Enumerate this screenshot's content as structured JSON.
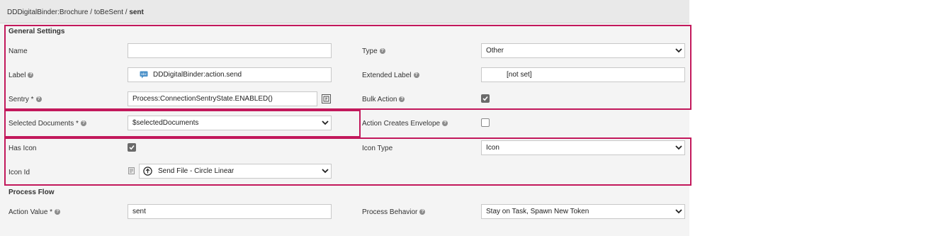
{
  "breadcrumb": {
    "path": "DDDigitalBinder:Brochure / toBeSent / ",
    "current": "sent"
  },
  "sections": {
    "general": "General Settings",
    "process": "Process Flow"
  },
  "fields": {
    "name": {
      "label": "Name",
      "value": ""
    },
    "type": {
      "label": "Type",
      "value": "Other"
    },
    "label": {
      "label": "Label",
      "value": "DDDigitalBinder:action.send"
    },
    "extended_label": {
      "label": "Extended Label",
      "value": "[not set]"
    },
    "sentry": {
      "label": "Sentry *",
      "value": "Process:ConnectionSentryState.ENABLED()"
    },
    "bulk_action": {
      "label": "Bulk Action",
      "checked": true
    },
    "selected_documents": {
      "label": "Selected Documents *",
      "value": "$selectedDocuments"
    },
    "action_creates_envelope": {
      "label": "Action Creates Envelope",
      "checked": false
    },
    "has_icon": {
      "label": "Has Icon",
      "checked": true
    },
    "icon_type": {
      "label": "Icon Type",
      "value": "Icon"
    },
    "icon_id": {
      "label": "Icon Id",
      "value": "Send File - Circle Linear"
    },
    "action_value": {
      "label": "Action Value *",
      "value": "sent"
    },
    "process_behavior": {
      "label": "Process Behavior",
      "value": "Stay on Task, Spawn New Token"
    }
  },
  "help_glyph": "?",
  "colors": {
    "highlight": "#c2185b",
    "panel": "#f4f4f4",
    "titlebar": "#e9e9e9"
  }
}
